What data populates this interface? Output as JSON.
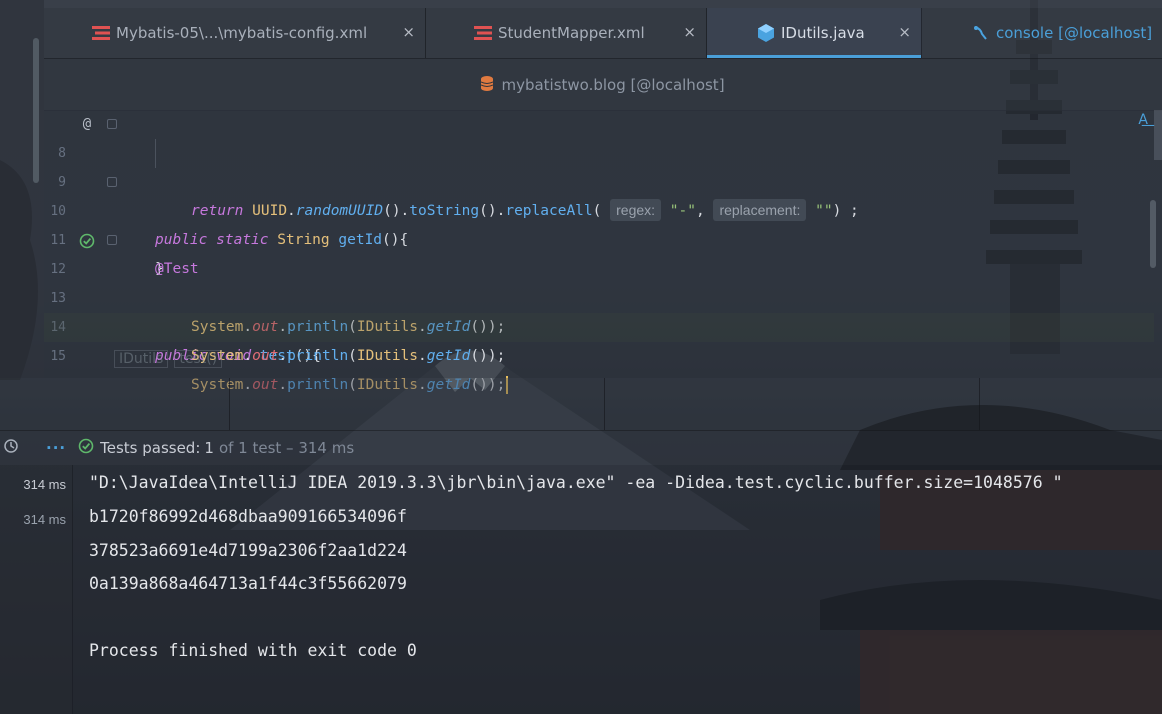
{
  "tabs": [
    {
      "label": "Mybatis-05\\...\\mybatis-config.xml",
      "icon": "xml-file-icon",
      "active": false
    },
    {
      "label": "StudentMapper.xml",
      "icon": "xml-file-icon",
      "active": false
    },
    {
      "label": "IDutils.java",
      "icon": "java-class-icon",
      "active": true
    },
    {
      "label": "console [@localhost]",
      "icon": "sql-console-icon",
      "active": false
    }
  ],
  "tab_close": "×",
  "datasource": "mybatistwo.blog [@localhost]",
  "editor": {
    "lines": [
      {
        "n": "8"
      },
      {
        "n": "9"
      },
      {
        "n": "10"
      },
      {
        "n": "11"
      },
      {
        "n": "12"
      },
      {
        "n": "13"
      },
      {
        "n": "14"
      },
      {
        "n": "15"
      }
    ],
    "hint_regex": "regex:",
    "hint_replacement": "replacement:",
    "breadcrumb": [
      "IDutils",
      "test()"
    ]
  },
  "tests": {
    "passed_label": "Tests passed:",
    "passed_count": "1",
    "of_text": "of 1 test – 314 ms"
  },
  "durations": [
    "314 ms",
    "314 ms"
  ],
  "console_lines": [
    "\"D:\\JavaIdea\\IntelliJ IDEA 2019.3.3\\jbr\\bin\\java.exe\" -ea -Didea.test.cyclic.buffer.size=1048576 \"",
    "b1720f86992d468dbaa909166534096f",
    "378523a6691e4d7199a2306f2aa1d224",
    "0a139a868a464713a1f44c3f55662079",
    "",
    "Process finished with exit code 0"
  ],
  "colors": {
    "accent": "#4a9fd8",
    "ok": "#5fb86b"
  }
}
